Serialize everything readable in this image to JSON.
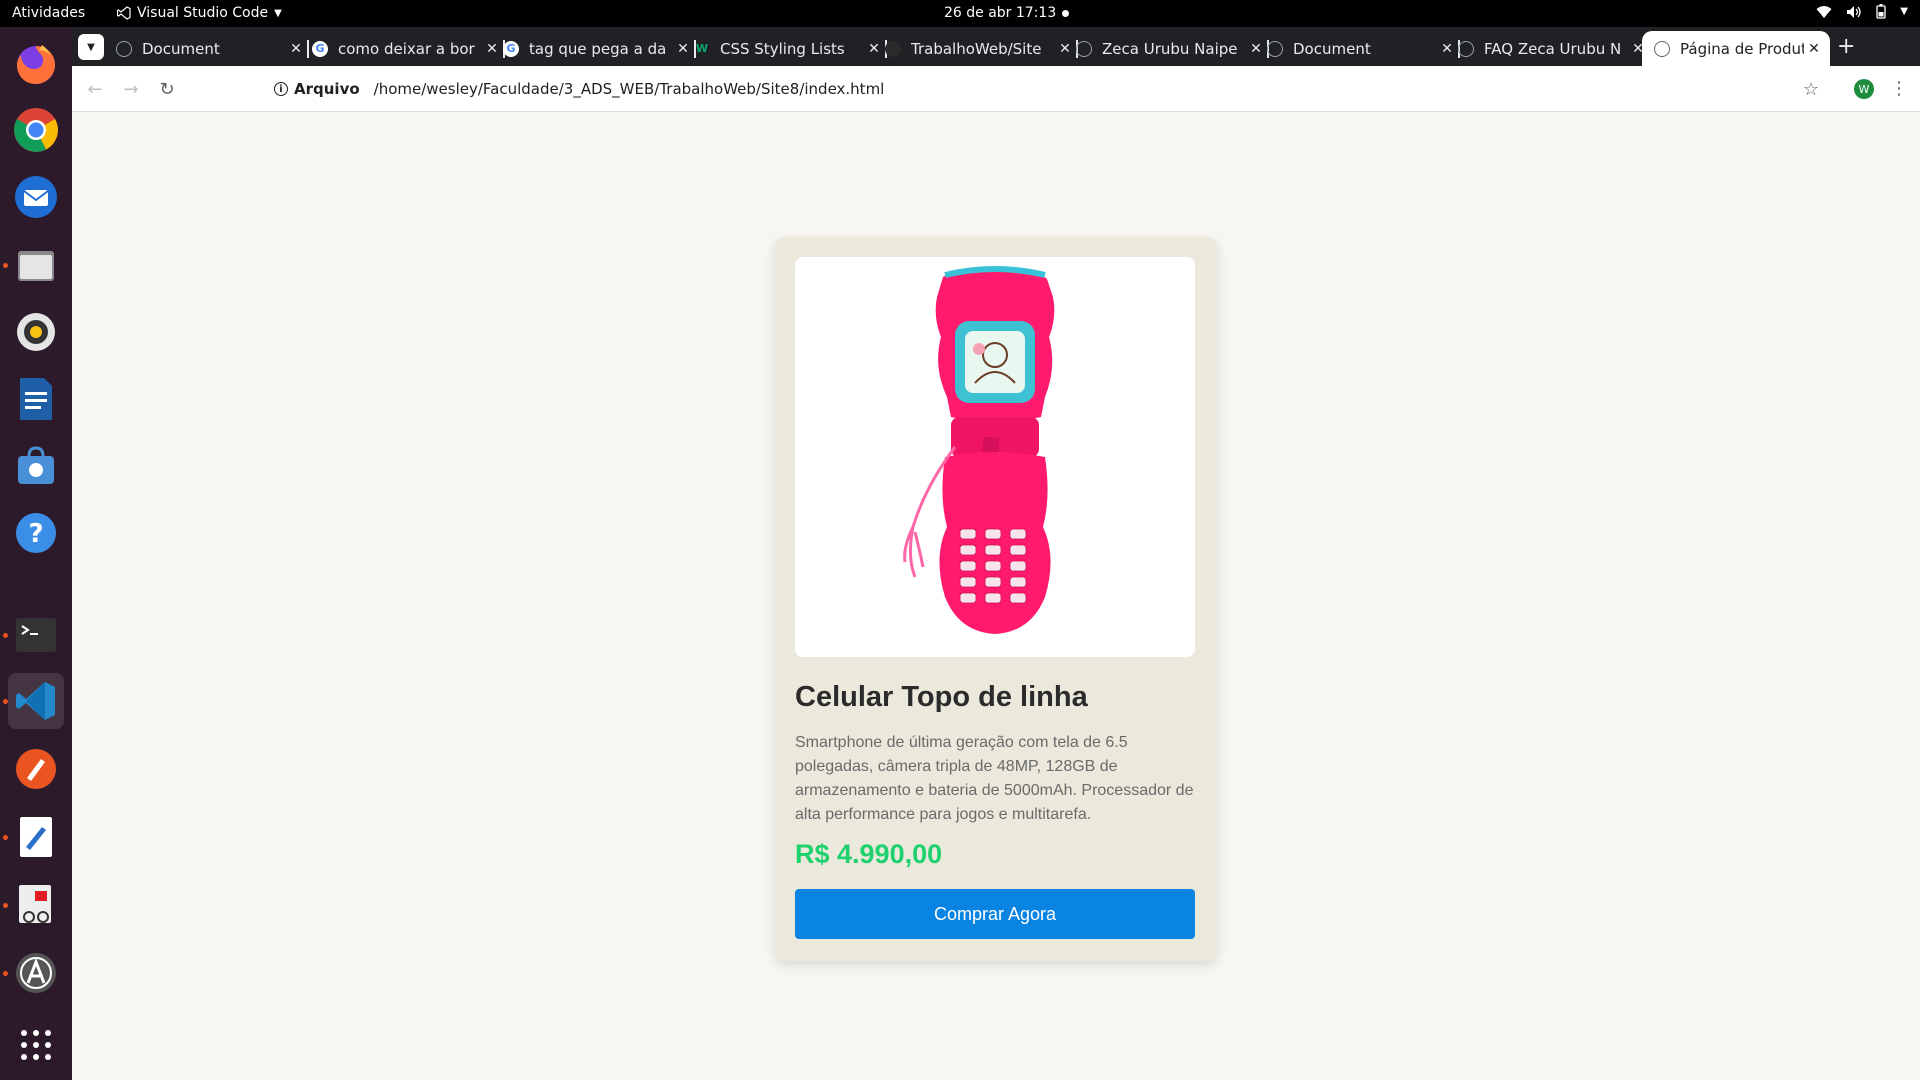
{
  "system": {
    "activities": "Atividades",
    "app_menu": "Visual Studio Code",
    "clock": "26 de abr  17:13"
  },
  "browser": {
    "tabs": [
      {
        "title": "Document",
        "favicon": "globe-icon"
      },
      {
        "title": "como deixar a bor",
        "favicon": "google-icon"
      },
      {
        "title": "tag que pega a da",
        "favicon": "google-icon"
      },
      {
        "title": "CSS Styling Lists",
        "favicon": "w3schools-icon"
      },
      {
        "title": "TrabalhoWeb/Site",
        "favicon": "github-icon"
      },
      {
        "title": "Zeca Urubu Naipe",
        "favicon": "globe-icon"
      },
      {
        "title": "Document",
        "favicon": "globe-icon"
      },
      {
        "title": "FAQ Zeca Urubu N",
        "favicon": "globe-icon"
      },
      {
        "title": "Página de Produto",
        "favicon": "globe-icon",
        "active": true
      }
    ],
    "address": {
      "scheme_label": "Arquivo",
      "url": "/home/wesley/Faculdade/3_ADS_WEB/TrabalhoWeb/Site8/index.html"
    },
    "profile_initial": "W"
  },
  "product": {
    "title": "Celular Topo de linha",
    "description": "Smartphone de última geração com tela de 6.5 polegadas, câmera tripla de 48MP, 128GB de armazenamento e bateria de 5000mAh. Processador de alta performance para jogos e multitarefa.",
    "price": "R$ 4.990,00",
    "buy_label": "Comprar Agora",
    "image": "pink-toy-flip-phone"
  },
  "colors": {
    "price": "#1fd16e",
    "button": "#0984e3",
    "card": "#ebe8dc",
    "page_bg": "#f8f6f1"
  }
}
